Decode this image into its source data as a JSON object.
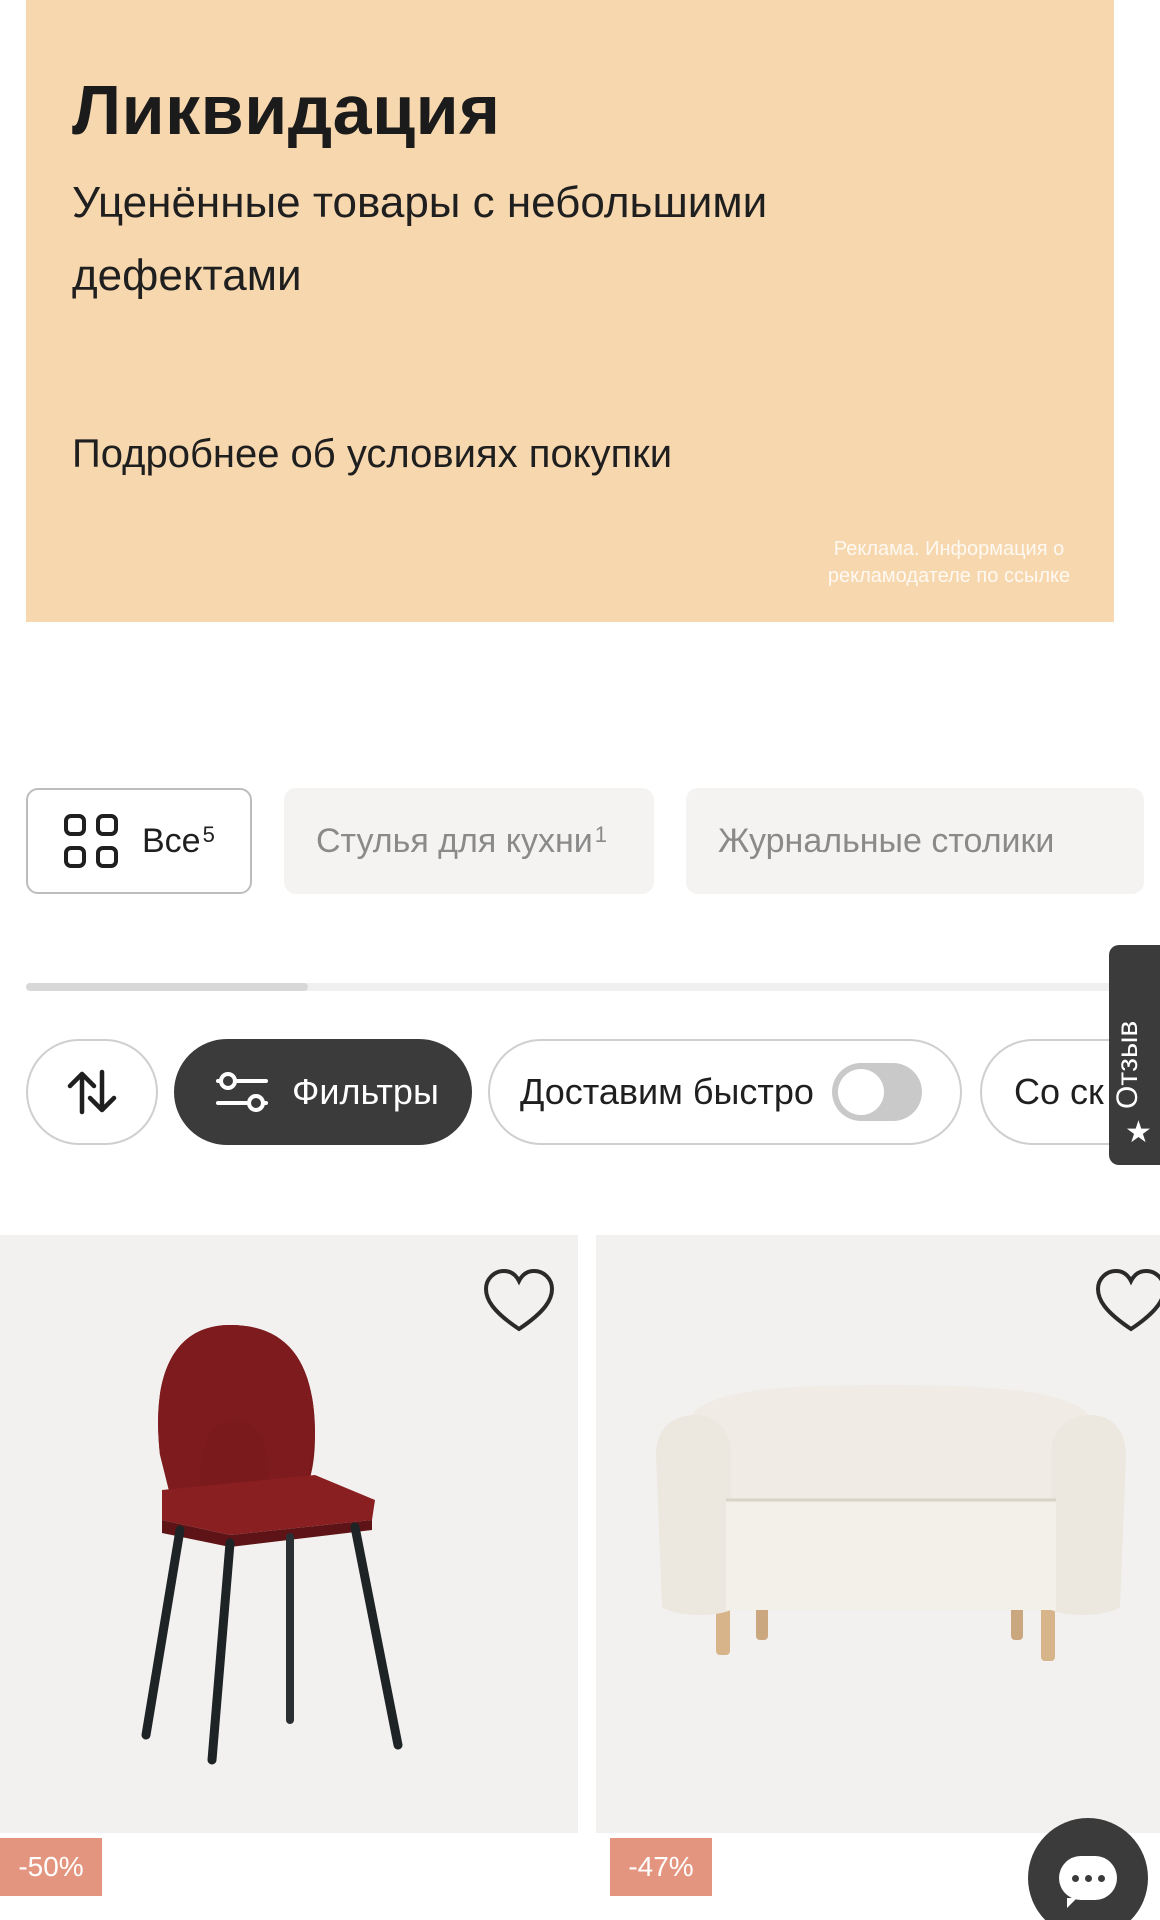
{
  "banner": {
    "title": "Ликвидация",
    "subtitle": "Уценённые товары с небольшими дефектами",
    "link": "Подробнее об условиях покупки",
    "ad_text": "Реклама. Информация о рекламодателе по ссылке",
    "background": "#f7d7ae"
  },
  "categories": {
    "all": {
      "label": "Все",
      "count": "5"
    },
    "kitchen_chairs": {
      "label": "Стулья для кухни",
      "count": "1"
    },
    "coffee_tables": {
      "label": "Журнальные столики"
    }
  },
  "filters": {
    "sort_icon": "sort-arrows-icon",
    "filters_label": "Фильтры",
    "fast_delivery_label": "Доставим быстро",
    "fast_delivery_enabled": false,
    "discount_label": "Со ск"
  },
  "side_tab": {
    "label": "Отзыв"
  },
  "products": [
    {
      "name": "chair",
      "discount": "-50%"
    },
    {
      "name": "sofa",
      "discount": "-47%"
    }
  ],
  "colors": {
    "dark": "#3b3b3b",
    "discount_badge": "#e4957f",
    "card_bg": "#f3f1ef"
  }
}
